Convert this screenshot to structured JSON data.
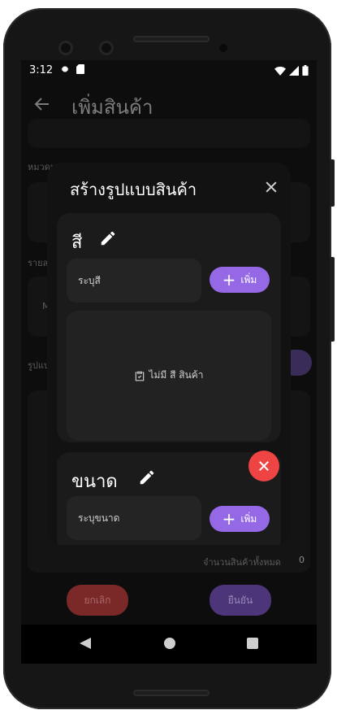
{
  "status": {
    "time": "3:12"
  },
  "appbar": {
    "title": "เพิ่มสินค้า"
  },
  "background": {
    "category_label": "หมวดหมู่สินค้า",
    "details_label": "รายละ",
    "details_value": "M",
    "variants_label": "รูปแบ",
    "total_label": "จำนวนสินค้าทั้งหมด",
    "total_value": "0",
    "cancel_label": "ยกเลิก",
    "confirm_label": "ยืนยัน"
  },
  "dialog": {
    "title": "สร้างรูปแบบสินค้า",
    "color_card": {
      "title": "สี",
      "placeholder": "ระบุสี",
      "add_label": "เพิ่ม",
      "empty_text": "ไม่มี สี สินค้า"
    },
    "size_card": {
      "title": "ขนาด",
      "placeholder": "ระบุขนาด",
      "add_label": "เพิ่ม"
    }
  },
  "colors": {
    "accent": "#9568e6",
    "danger": "#ef4444",
    "cancel_dim": "#7a2828",
    "confirm_dim": "#4c3578"
  }
}
